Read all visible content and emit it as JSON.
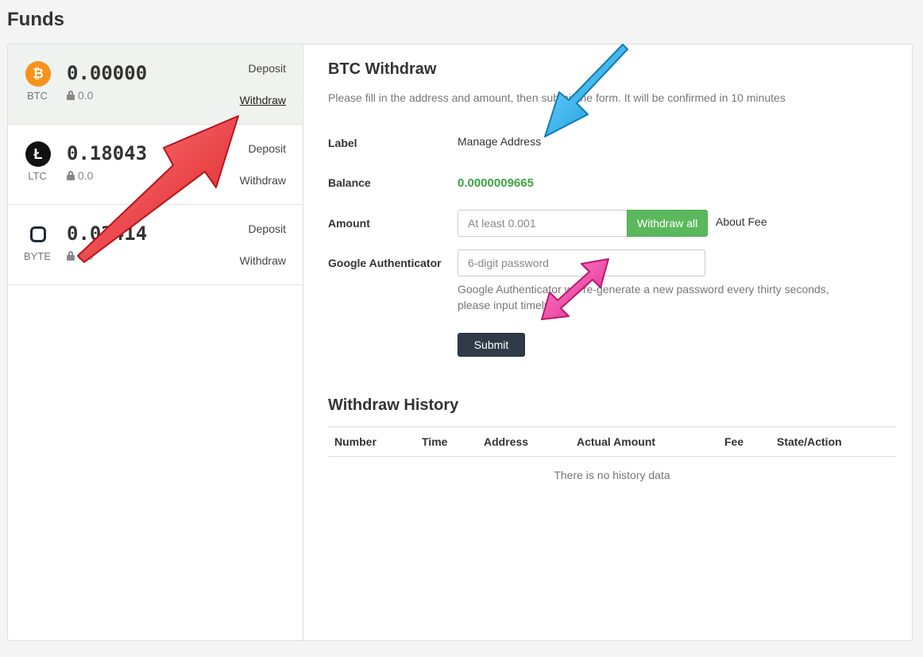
{
  "page": {
    "title": "Funds"
  },
  "coins": [
    {
      "symbol": "BTC",
      "icon": "bitcoin-icon",
      "glyph": "₿",
      "balance": "0.00000",
      "locked": "0.0",
      "deposit": "Deposit",
      "withdraw": "Withdraw"
    },
    {
      "symbol": "LTC",
      "icon": "litecoin-icon",
      "glyph": "Ł",
      "balance": "0.18043",
      "locked": "0.0",
      "deposit": "Deposit",
      "withdraw": "Withdraw"
    },
    {
      "symbol": "BYTE",
      "icon": "byteball-icon",
      "glyph": "",
      "balance": "0.02414",
      "locked": "0.0",
      "deposit": "Deposit",
      "withdraw": "Withdraw"
    }
  ],
  "form": {
    "title": "BTC Withdraw",
    "hint": "Please fill in the address and amount, then submit the form. It will be confirmed in 10 minutes",
    "label_label": "Label",
    "manage_address": "Manage Address",
    "balance_label": "Balance",
    "balance_value": "0.0000009665",
    "amount_label": "Amount",
    "amount_placeholder": "At least 0.001",
    "withdraw_all": "Withdraw all",
    "about_fee": "About Fee",
    "ga_label": "Google Authenticator",
    "ga_placeholder": "6-digit password",
    "ga_help": "Google Authenticator will re-generate a new password every thirty seconds, please input timely",
    "submit": "Submit"
  },
  "history": {
    "title": "Withdraw History",
    "columns": [
      "Number",
      "Time",
      "Address",
      "Actual Amount",
      "Fee",
      "State/Action"
    ],
    "empty": "There is no history data"
  },
  "colors": {
    "accent_green": "#5cb85c",
    "balance_green": "#3aa542",
    "btc_orange": "#f7931a",
    "submit_dark": "#2f3b48",
    "annotation_red": "#e8363b",
    "annotation_blue": "#1aa7e8",
    "annotation_pink": "#e8369a"
  }
}
